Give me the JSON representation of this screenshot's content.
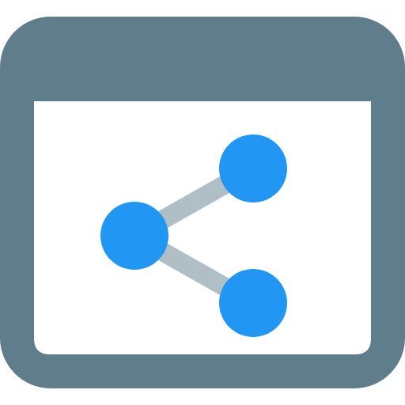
{
  "icon": {
    "name": "browser-window-share-icon",
    "parts": {
      "window": "browser-window-icon",
      "share": "share-icon"
    }
  },
  "colors": {
    "frame": "#607d8b",
    "content": "#ffffff",
    "connector": "#b0bec5",
    "node": "#2196f3"
  }
}
